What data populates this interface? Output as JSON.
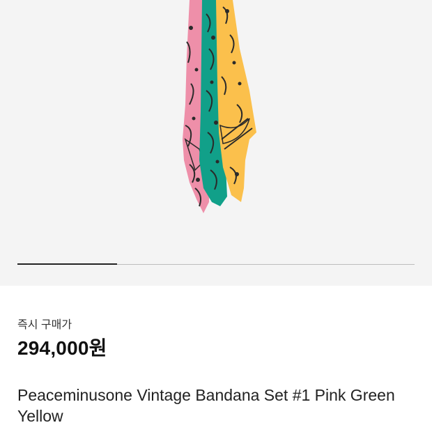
{
  "product": {
    "image_alt": "bandana-set-image",
    "carousel": {
      "current": 1,
      "total": 4
    },
    "price_label": "즉시 구매가",
    "price": "294,000원",
    "title": "Peaceminusone Vintage Bandana Set #1 Pink Green Yellow"
  },
  "colors": {
    "pink": "#ee8fa9",
    "green": "#11a089",
    "yellow": "#fbc04c",
    "pattern": "#2a2a2a",
    "background": "#f4f4f4"
  }
}
